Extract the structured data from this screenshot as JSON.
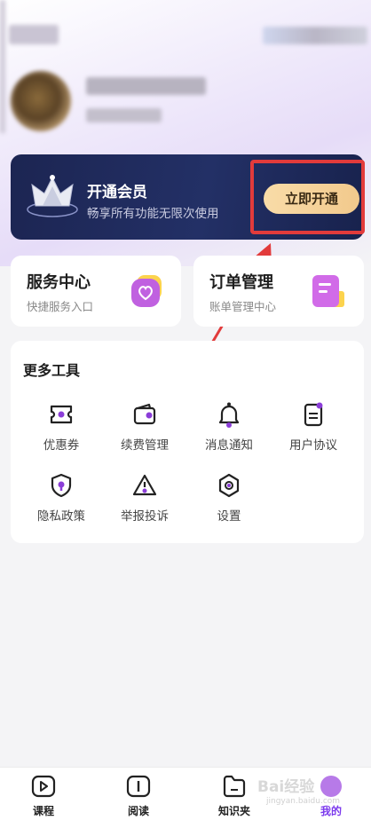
{
  "vip": {
    "title": "开通会员",
    "subtitle": "畅享所有功能无限次使用",
    "button": "立即开通"
  },
  "service_center": {
    "title": "服务中心",
    "subtitle": "快捷服务入口"
  },
  "orders": {
    "title": "订单管理",
    "subtitle": "账单管理中心"
  },
  "tools": {
    "title": "更多工具",
    "items": [
      {
        "label": "优惠券",
        "icon": "coupon-icon"
      },
      {
        "label": "续费管理",
        "icon": "wallet-icon"
      },
      {
        "label": "消息通知",
        "icon": "bell-icon"
      },
      {
        "label": "用户协议",
        "icon": "document-icon"
      },
      {
        "label": "隐私政策",
        "icon": "shield-icon"
      },
      {
        "label": "举报投诉",
        "icon": "warning-icon"
      },
      {
        "label": "设置",
        "icon": "gear-icon"
      }
    ]
  },
  "tabbar": {
    "items": [
      {
        "label": "课程",
        "icon": "play-icon"
      },
      {
        "label": "阅读",
        "icon": "read-icon"
      },
      {
        "label": "知识夹",
        "icon": "folder-icon"
      },
      {
        "label": "我的",
        "icon": "profile-icon"
      }
    ]
  },
  "watermark": {
    "text": "Bai经验",
    "sub": "jingyan.baidu.com"
  },
  "colors": {
    "accent": "#7c3aed",
    "vip_bg": "#1f2a5c",
    "highlight": "#e23b3b"
  }
}
